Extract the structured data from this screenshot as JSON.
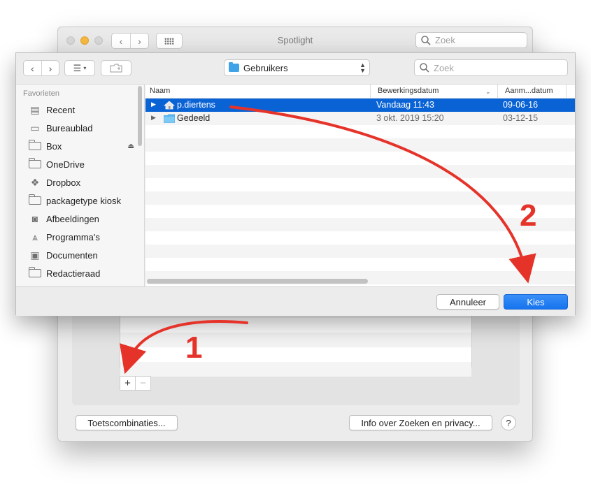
{
  "colors": {
    "accent": "#0a63d5",
    "primary_button": "#1674ee",
    "annotation": "#e5332a",
    "folder": "#3fa3e8"
  },
  "spotlight_window": {
    "title": "Spotlight",
    "search": {
      "placeholder": "Zoek"
    },
    "add_label": "+",
    "remove_label": "−",
    "shortcuts_button": "Toetscombinaties...",
    "privacy_button": "Info over Zoeken en privacy...",
    "help_label": "?"
  },
  "sheet": {
    "path_popup": "Gebruikers",
    "search": {
      "placeholder": "Zoek"
    },
    "sidebar": {
      "heading": "Favorieten",
      "items": [
        {
          "label": "Recent",
          "icon": "recent-icon"
        },
        {
          "label": "Bureaublad",
          "icon": "desktop-icon"
        },
        {
          "label": "Box",
          "icon": "folder-icon",
          "eject": true
        },
        {
          "label": "OneDrive",
          "icon": "folder-icon"
        },
        {
          "label": "Dropbox",
          "icon": "dropbox-icon"
        },
        {
          "label": "packagetype kiosk",
          "icon": "folder-icon"
        },
        {
          "label": "Afbeeldingen",
          "icon": "camera-icon"
        },
        {
          "label": "Programma's",
          "icon": "applications-icon"
        },
        {
          "label": "Documenten",
          "icon": "documents-icon"
        },
        {
          "label": "Redactieraad",
          "icon": "folder-icon"
        }
      ]
    },
    "columns": {
      "name": "Naam",
      "modified": "Bewerkingsdatum",
      "created": "Aanm...datum"
    },
    "files": [
      {
        "name": "p.diertens",
        "modified": "Vandaag 11:43",
        "created": "09-06-16",
        "icon": "home-icon",
        "selected": true
      },
      {
        "name": "Gedeeld",
        "modified": "3 okt. 2019 15:20",
        "created": "03-12-15",
        "icon": "folder-icon",
        "selected": false
      }
    ],
    "cancel_button": "Annuleer",
    "choose_button": "Kies"
  },
  "annotations": {
    "step1": "1",
    "step2": "2"
  }
}
